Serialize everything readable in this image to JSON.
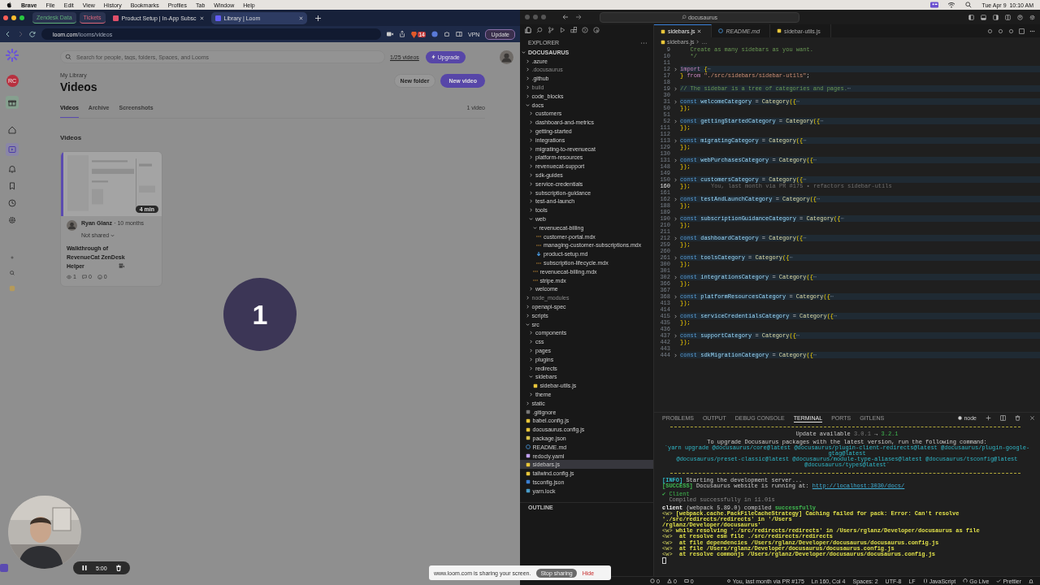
{
  "menu_bar": {
    "app": "Brave",
    "items": [
      "File",
      "Edit",
      "View",
      "History",
      "Bookmarks",
      "Profiles",
      "Tab",
      "Window",
      "Help"
    ],
    "clock": "Tue Apr 9  10:10 AM"
  },
  "browser": {
    "tabs": [
      {
        "label": "Zendesk Data",
        "kind": "group",
        "color": "#5fae7a",
        "selected": false
      },
      {
        "label": "Tickets",
        "kind": "group",
        "color": "#d9667a",
        "selected": false
      },
      {
        "label": "Product Setup | In-App Subsc",
        "kind": "page",
        "color": "#e0506a",
        "selected": false
      },
      {
        "label": "Library | Loom",
        "kind": "page",
        "color": "#625df5",
        "selected": true
      }
    ],
    "url_host": "loom.com",
    "url_path": "/looms/videos",
    "shields_count": "14",
    "vpn": "VPN",
    "update_button": "Update"
  },
  "loom": {
    "org_badge": "RC",
    "search": {
      "placeholder": "Search for people, tags, folders, Spaces, and Looms"
    },
    "quota": "1/25 videos",
    "upgrade_button": "Upgrade",
    "breadcrumb": "My Library",
    "title": "Videos",
    "new_folder_button": "New folder",
    "new_video_button": "New video",
    "tabs": [
      {
        "label": "Videos",
        "selected": true
      },
      {
        "label": "Archive",
        "selected": false
      },
      {
        "label": "Screenshots",
        "selected": false
      }
    ],
    "count": "1 video",
    "section": "Videos",
    "video": {
      "duration": "4 min",
      "author": "Ryan Glanz",
      "age": "· 10 months",
      "sharing": "Not shared",
      "title": "Walkthrough of RevenueCat ZenDesk Helper",
      "views": "1",
      "comments": "0",
      "reactions": "0"
    },
    "countdown": "1",
    "recording_time": "5:00"
  },
  "share_banner": {
    "text": "www.loom.com is sharing your screen.",
    "stop_button": "Stop sharing",
    "hide_button": "Hide"
  },
  "vscode": {
    "search": "docusaurus",
    "explorer_title": "EXPLORER",
    "outline": "OUTLINE",
    "tree": {
      "name": "DOCUSAURUS",
      "kind": "folder",
      "expanded": true,
      "selected": false,
      "ignored": false,
      "children": [
        {
          "name": ".azure",
          "kind": "folder",
          "expanded": false,
          "selected": false,
          "ignored": false
        },
        {
          "name": ".docusaurus",
          "kind": "folder",
          "expanded": false,
          "selected": false,
          "ignored": true
        },
        {
          "name": ".github",
          "kind": "folder",
          "expanded": false,
          "selected": false,
          "ignored": false
        },
        {
          "name": "build",
          "kind": "folder",
          "expanded": false,
          "selected": false,
          "ignored": true
        },
        {
          "name": "code_blocks",
          "kind": "folder",
          "expanded": false,
          "selected": false,
          "ignored": false
        },
        {
          "name": "docs",
          "kind": "folder",
          "expanded": true,
          "selected": false,
          "ignored": false,
          "children": [
            {
              "name": "customers",
              "kind": "folder",
              "expanded": false,
              "selected": false,
              "ignored": false
            },
            {
              "name": "dashboard-and-metrics",
              "kind": "folder",
              "expanded": false,
              "selected": false,
              "ignored": false
            },
            {
              "name": "getting-started",
              "kind": "folder",
              "expanded": false,
              "selected": false,
              "ignored": false
            },
            {
              "name": "integrations",
              "kind": "folder",
              "expanded": false,
              "selected": false,
              "ignored": false
            },
            {
              "name": "migrating-to-revenuecat",
              "kind": "folder",
              "expanded": false,
              "selected": false,
              "ignored": false
            },
            {
              "name": "platform-resources",
              "kind": "folder",
              "expanded": false,
              "selected": false,
              "ignored": false
            },
            {
              "name": "revenuecat-support",
              "kind": "folder",
              "expanded": false,
              "selected": false,
              "ignored": false
            },
            {
              "name": "sdk-guides",
              "kind": "folder",
              "expanded": false,
              "selected": false,
              "ignored": false
            },
            {
              "name": "service-credentials",
              "kind": "folder",
              "expanded": false,
              "selected": false,
              "ignored": false
            },
            {
              "name": "subscription-guidance",
              "kind": "folder",
              "expanded": false,
              "selected": false,
              "ignored": false
            },
            {
              "name": "test-and-launch",
              "kind": "folder",
              "expanded": false,
              "selected": false,
              "ignored": false
            },
            {
              "name": "tools",
              "kind": "folder",
              "expanded": false,
              "selected": false,
              "ignored": false
            },
            {
              "name": "web",
              "kind": "folder",
              "expanded": true,
              "selected": false,
              "ignored": false,
              "children": [
                {
                  "name": "revenuecat-billing",
                  "kind": "folder",
                  "expanded": true,
                  "selected": false,
                  "ignored": false,
                  "children": [
                    {
                      "name": "customer-portal.mdx",
                      "kind": "mdx",
                      "selected": false,
                      "ignored": false
                    },
                    {
                      "name": "managing-customer-subscriptions.mdx",
                      "kind": "mdx",
                      "selected": false,
                      "ignored": false
                    },
                    {
                      "name": "product-setup.md",
                      "kind": "md",
                      "selected": false,
                      "ignored": false
                    },
                    {
                      "name": "subscription-lifecycle.mdx",
                      "kind": "mdx",
                      "selected": false,
                      "ignored": false
                    }
                  ]
                },
                {
                  "name": "revenuecat-billing.mdx",
                  "kind": "mdx",
                  "selected": false,
                  "ignored": false
                },
                {
                  "name": "stripe.mdx",
                  "kind": "mdx",
                  "selected": false,
                  "ignored": false
                }
              ]
            },
            {
              "name": "welcome",
              "kind": "folder",
              "expanded": false,
              "selected": false,
              "ignored": false
            }
          ]
        },
        {
          "name": "node_modules",
          "kind": "folder",
          "expanded": false,
          "selected": false,
          "ignored": true
        },
        {
          "name": "openapi-spec",
          "kind": "folder",
          "expanded": false,
          "selected": false,
          "ignored": false
        },
        {
          "name": "scripts",
          "kind": "folder",
          "expanded": false,
          "selected": false,
          "ignored": false
        },
        {
          "name": "src",
          "kind": "folder",
          "expanded": true,
          "selected": false,
          "ignored": false,
          "children": [
            {
              "name": "components",
              "kind": "folder",
              "expanded": false,
              "selected": false,
              "ignored": false
            },
            {
              "name": "css",
              "kind": "folder",
              "expanded": false,
              "selected": false,
              "ignored": false
            },
            {
              "name": "pages",
              "kind": "folder",
              "expanded": false,
              "selected": false,
              "ignored": false
            },
            {
              "name": "plugins",
              "kind": "folder",
              "expanded": false,
              "selected": false,
              "ignored": false
            },
            {
              "name": "redirects",
              "kind": "folder",
              "expanded": false,
              "selected": false,
              "ignored": false
            },
            {
              "name": "sidebars",
              "kind": "folder",
              "expanded": true,
              "selected": false,
              "ignored": false,
              "children": [
                {
                  "name": "sidebar-utils.js",
                  "kind": "js",
                  "selected": false,
                  "ignored": false
                }
              ]
            },
            {
              "name": "theme",
              "kind": "folder",
              "expanded": false,
              "selected": false,
              "ignored": false
            }
          ]
        },
        {
          "name": "static",
          "kind": "folder",
          "expanded": false,
          "selected": false,
          "ignored": false
        },
        {
          "name": ".gitignore",
          "kind": "git",
          "selected": false,
          "ignored": false
        },
        {
          "name": "babel.config.js",
          "kind": "babel",
          "selected": false,
          "ignored": false
        },
        {
          "name": "docusaurus.config.js",
          "kind": "js",
          "selected": false,
          "ignored": false
        },
        {
          "name": "package.json",
          "kind": "json",
          "selected": false,
          "ignored": false
        },
        {
          "name": "README.md",
          "kind": "info",
          "selected": false,
          "ignored": false
        },
        {
          "name": "redocly.yaml",
          "kind": "yaml",
          "selected": false,
          "ignored": false
        },
        {
          "name": "sidebars.js",
          "kind": "js",
          "selected": true,
          "ignored": false
        },
        {
          "name": "tailwind.config.js",
          "kind": "js",
          "selected": false,
          "ignored": false
        },
        {
          "name": "tsconfig.json",
          "kind": "ts",
          "selected": false,
          "ignored": false
        },
        {
          "name": "yarn.lock",
          "kind": "yarn",
          "selected": false,
          "ignored": false
        }
      ]
    },
    "editor_tabs": [
      {
        "label": "sidebars.js",
        "kind": "js",
        "selected": true,
        "preview": false
      },
      {
        "label": "README.md",
        "kind": "info",
        "selected": false,
        "preview": true
      },
      {
        "label": "sidebar-utils.js",
        "kind": "js",
        "selected": false,
        "preview": false
      }
    ],
    "breadcrumb": [
      "sidebars.js",
      "…"
    ],
    "code": [
      {
        "n": "9",
        "fold": false,
        "current": false,
        "kind": "comment",
        "parts": [
          "   Create as many sidebars as you want."
        ]
      },
      {
        "n": "10",
        "fold": false,
        "current": false,
        "kind": "comment",
        "parts": [
          "   */"
        ]
      },
      {
        "n": "11",
        "fold": false,
        "current": false,
        "kind": "blank"
      },
      {
        "n": "12",
        "fold": true,
        "current": false,
        "kind": "import",
        "parts": [
          "import ",
          "{",
          "⋯"
        ]
      },
      {
        "n": "17",
        "fold": false,
        "current": false,
        "kind": "from",
        "parts": [
          "} ",
          "from ",
          "\"./src/sidebars/sidebar-utils\"",
          ";"
        ]
      },
      {
        "n": "18",
        "fold": false,
        "current": false,
        "kind": "blank"
      },
      {
        "n": "19",
        "fold": true,
        "current": false,
        "kind": "comment",
        "parts": [
          "// The sidebar is a tree of categories and pages.",
          "⋯"
        ]
      },
      {
        "n": "30",
        "fold": false,
        "current": false,
        "kind": "blank"
      },
      {
        "n": "31",
        "fold": true,
        "current": false,
        "kind": "decl",
        "parts": [
          "const ",
          "welcomeCategory ",
          "= ",
          "Category",
          "({",
          "⋯"
        ]
      },
      {
        "n": "50",
        "fold": false,
        "current": false,
        "kind": "close",
        "parts": [
          "});"
        ]
      },
      {
        "n": "51",
        "fold": false,
        "current": false,
        "kind": "blank"
      },
      {
        "n": "52",
        "fold": true,
        "current": false,
        "kind": "decl",
        "parts": [
          "const ",
          "gettingStartedCategory ",
          "= ",
          "Category",
          "({",
          "⋯"
        ]
      },
      {
        "n": "111",
        "fold": false,
        "current": false,
        "kind": "close",
        "parts": [
          "});"
        ]
      },
      {
        "n": "112",
        "fold": false,
        "current": false,
        "kind": "blank"
      },
      {
        "n": "113",
        "fold": true,
        "current": false,
        "kind": "decl",
        "parts": [
          "const ",
          "migratingCategory ",
          "= ",
          "Category",
          "({",
          "⋯"
        ]
      },
      {
        "n": "129",
        "fold": false,
        "current": false,
        "kind": "close",
        "parts": [
          "});"
        ]
      },
      {
        "n": "130",
        "fold": false,
        "current": false,
        "kind": "blank"
      },
      {
        "n": "131",
        "fold": true,
        "current": false,
        "kind": "decl",
        "parts": [
          "const ",
          "webPurchasesCategory ",
          "= ",
          "Category",
          "({",
          "⋯"
        ]
      },
      {
        "n": "148",
        "fold": false,
        "current": false,
        "kind": "close",
        "parts": [
          "});"
        ]
      },
      {
        "n": "149",
        "fold": false,
        "current": false,
        "kind": "blank"
      },
      {
        "n": "150",
        "fold": true,
        "current": false,
        "kind": "decl",
        "parts": [
          "const ",
          "customersCategory ",
          "= ",
          "Category",
          "({",
          "⋯"
        ]
      },
      {
        "n": "160",
        "fold": false,
        "current": true,
        "kind": "close",
        "parts": [
          "});"
        ],
        "blame": "You, last month via PR #175 • refactors sidebar-utils"
      },
      {
        "n": "161",
        "fold": false,
        "current": false,
        "kind": "blank"
      },
      {
        "n": "162",
        "fold": true,
        "current": false,
        "kind": "decl",
        "parts": [
          "const ",
          "testAndLaunchCategory ",
          "= ",
          "Category",
          "({",
          "⋯"
        ]
      },
      {
        "n": "188",
        "fold": false,
        "current": false,
        "kind": "close",
        "parts": [
          "});"
        ]
      },
      {
        "n": "189",
        "fold": false,
        "current": false,
        "kind": "blank"
      },
      {
        "n": "190",
        "fold": true,
        "current": false,
        "kind": "decl",
        "parts": [
          "const ",
          "subscriptionGuidanceCategory ",
          "= ",
          "Category",
          "({",
          "⋯"
        ]
      },
      {
        "n": "210",
        "fold": false,
        "current": false,
        "kind": "close",
        "parts": [
          "});"
        ]
      },
      {
        "n": "211",
        "fold": false,
        "current": false,
        "kind": "blank"
      },
      {
        "n": "212",
        "fold": true,
        "current": false,
        "kind": "decl",
        "parts": [
          "const ",
          "dashboardCategory ",
          "= ",
          "Category",
          "({",
          "⋯"
        ]
      },
      {
        "n": "259",
        "fold": false,
        "current": false,
        "kind": "close",
        "parts": [
          "});"
        ]
      },
      {
        "n": "260",
        "fold": false,
        "current": false,
        "kind": "blank"
      },
      {
        "n": "261",
        "fold": true,
        "current": false,
        "kind": "decl",
        "parts": [
          "const ",
          "toolsCategory ",
          "= ",
          "Category",
          "({",
          "⋯"
        ]
      },
      {
        "n": "300",
        "fold": false,
        "current": false,
        "kind": "close",
        "parts": [
          "});"
        ]
      },
      {
        "n": "301",
        "fold": false,
        "current": false,
        "kind": "blank"
      },
      {
        "n": "302",
        "fold": true,
        "current": false,
        "kind": "decl",
        "parts": [
          "const ",
          "integrationsCategory ",
          "= ",
          "Category",
          "({",
          "⋯"
        ]
      },
      {
        "n": "366",
        "fold": false,
        "current": false,
        "kind": "close",
        "parts": [
          "});"
        ]
      },
      {
        "n": "367",
        "fold": false,
        "current": false,
        "kind": "blank"
      },
      {
        "n": "368",
        "fold": true,
        "current": false,
        "kind": "decl",
        "parts": [
          "const ",
          "platformResourcesCategory ",
          "= ",
          "Category",
          "({",
          "⋯"
        ]
      },
      {
        "n": "413",
        "fold": false,
        "current": false,
        "kind": "close",
        "parts": [
          "});"
        ]
      },
      {
        "n": "414",
        "fold": false,
        "current": false,
        "kind": "blank"
      },
      {
        "n": "415",
        "fold": true,
        "current": false,
        "kind": "decl",
        "parts": [
          "const ",
          "serviceCredentialsCategory ",
          "= ",
          "Category",
          "({",
          "⋯"
        ]
      },
      {
        "n": "435",
        "fold": false,
        "current": false,
        "kind": "close",
        "parts": [
          "});"
        ]
      },
      {
        "n": "436",
        "fold": false,
        "current": false,
        "kind": "blank"
      },
      {
        "n": "437",
        "fold": true,
        "current": false,
        "kind": "decl",
        "parts": [
          "const ",
          "supportCategory ",
          "= ",
          "Category",
          "({",
          "⋯"
        ]
      },
      {
        "n": "442",
        "fold": false,
        "current": false,
        "kind": "close",
        "parts": [
          "});"
        ]
      },
      {
        "n": "443",
        "fold": false,
        "current": false,
        "kind": "blank"
      },
      {
        "n": "444",
        "fold": true,
        "current": false,
        "kind": "decl",
        "parts": [
          "const ",
          "sdkMigrationCategory ",
          "= ",
          "Category",
          "({",
          "⋯"
        ]
      }
    ],
    "panel_tabs": [
      {
        "label": "PROBLEMS",
        "selected": false
      },
      {
        "label": "OUTPUT",
        "selected": false
      },
      {
        "label": "DEBUG CONSOLE",
        "selected": false
      },
      {
        "label": "TERMINAL",
        "selected": true
      },
      {
        "label": "PORTS",
        "selected": false
      },
      {
        "label": "GITLENS",
        "selected": false
      }
    ],
    "terminal_name": "node",
    "terminal": [
      {
        "kind": "rule"
      },
      {
        "kind": "blank"
      },
      {
        "kind": "update",
        "parts": [
          "Update available ",
          "3.0.1",
          " → ",
          "3.2.1"
        ]
      },
      {
        "kind": "blank"
      },
      {
        "kind": "banner",
        "parts": [
          "To upgrade Docusaurus packages with the latest version, run the following command:"
        ]
      },
      {
        "kind": "command",
        "parts": [
          "`yarn upgrade @docusaurus/core@latest @docusaurus/plugin-client-redirects@latest @docusaurus/plugin-google-gtag@latest"
        ]
      },
      {
        "kind": "command",
        "parts": [
          "@docusaurus/preset-classic@latest @docusaurus/module-type-aliases@latest @docusaurus/tsconfig@latest"
        ]
      },
      {
        "kind": "command",
        "parts": [
          "@docusaurus/types@latest`"
        ]
      },
      {
        "kind": "blank"
      },
      {
        "kind": "rule"
      },
      {
        "kind": "blank"
      },
      {
        "kind": "info",
        "parts": [
          "[INFO]",
          " Starting the development server..."
        ]
      },
      {
        "kind": "success",
        "parts": [
          "[SUCCESS]",
          " Docusaurus website is running at: ",
          "http://localhost:3030/docs/"
        ]
      },
      {
        "kind": "blank"
      },
      {
        "kind": "ok",
        "parts": [
          "✔ Client"
        ]
      },
      {
        "kind": "note",
        "parts": [
          "  Compiled successfully in 11.01s"
        ]
      },
      {
        "kind": "blank"
      },
      {
        "kind": "compiled",
        "parts": [
          "client",
          " (webpack 5.89.0) compiled ",
          "successfully"
        ]
      },
      {
        "kind": "warn",
        "parts": [
          "<w>",
          " [webpack.cache.PackFileCacheStrategy] Caching failed for pack: Error: Can't resolve './src/redirects/redirects' in '/Users"
        ]
      },
      {
        "kind": "warn_cont",
        "parts": [
          "/rglanz/Developer/docusaurus'"
        ]
      },
      {
        "kind": "warn",
        "parts": [
          "<w>",
          " while resolving './src/redirects/redirects' in /Users/rglanz/Developer/docusaurus as file"
        ]
      },
      {
        "kind": "warn",
        "parts": [
          "<w>",
          "  at resolve esm file ./src/redirects/redirects"
        ]
      },
      {
        "kind": "warn",
        "parts": [
          "<w>",
          "  at file dependencies /Users/rglanz/Developer/docusaurus/docusaurus.config.js"
        ]
      },
      {
        "kind": "warn",
        "parts": [
          "<w>",
          "  at file /Users/rglanz/Developer/docusaurus/docusaurus.config.js"
        ]
      },
      {
        "kind": "warn",
        "parts": [
          "<w>",
          "  at resolve commonjs /Users/rglanz/Developer/docusaurus/docusaurus.config.js"
        ]
      },
      {
        "kind": "cursor"
      }
    ],
    "status_left": [
      {
        "kind": "error",
        "text": "0"
      },
      {
        "kind": "warning",
        "text": "0"
      },
      {
        "kind": "ports",
        "text": "0"
      }
    ],
    "status_right": [
      {
        "kind": "git",
        "text": "You, last month via PR #175"
      },
      {
        "kind": "text",
        "text": "Ln 160, Col 4"
      },
      {
        "kind": "text",
        "text": "Spaces: 2"
      },
      {
        "kind": "text",
        "text": "UTF-8"
      },
      {
        "kind": "text",
        "text": "LF"
      },
      {
        "kind": "braces",
        "text": "JavaScript"
      },
      {
        "kind": "broadcast",
        "text": "Go Live"
      },
      {
        "kind": "check",
        "text": "Prettier"
      },
      {
        "kind": "bell"
      }
    ]
  }
}
